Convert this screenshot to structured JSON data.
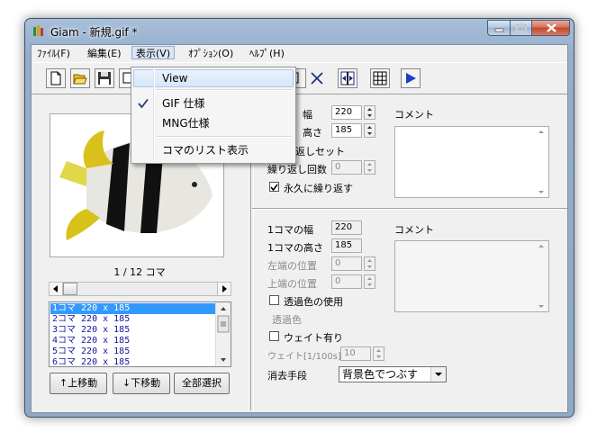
{
  "window": {
    "title": "Giam - 新規.gif *"
  },
  "menubar": {
    "items": [
      "ﾌｧｲﾙ(F)",
      "編集(E)",
      "表示(V)",
      "ｵﾌﾟｼｮﾝ(O)",
      "ﾍﾙﾌﾟ(H)"
    ]
  },
  "view_menu": {
    "items": [
      "View",
      "GIF 仕様",
      "MNG仕様",
      "コマのリスト表示"
    ],
    "checked_item": "GIF 仕様"
  },
  "left": {
    "frame_counter": "1 / 12 コマ",
    "frames": [
      "1コマ 220 x 185",
      "2コマ 220 x 185",
      "3コマ 220 x 185",
      "4コマ 220 x 185",
      "5コマ 220 x 185",
      "6コマ 220 x 185"
    ],
    "move_up_label": "↑上移動",
    "move_down_label": "↓下移動",
    "select_all_label": "全部選択"
  },
  "global": {
    "width_label": "幅",
    "width_value": "220",
    "height_label": "高さ",
    "height_value": "185",
    "loop_set_label": "返しセット",
    "loop_count_label": "繰り返し回数",
    "loop_count_value": "0",
    "loop_forever_label": "永久に繰り返す",
    "comment_label": "コメント"
  },
  "frame": {
    "width_label": "1コマの幅",
    "width_value": "220",
    "height_label": "1コマの高さ",
    "height_value": "185",
    "left_label": "左端の位置",
    "left_value": "0",
    "top_label": "上端の位置",
    "top_value": "0",
    "transparent_label": "透過色の使用",
    "transparent_color_label": "透過色",
    "wait_label": "ウェイト有り",
    "wait_time_label": "ウェイト[1/100s]",
    "wait_time_value": "10",
    "dispose_label": "消去手段",
    "dispose_value": "背景色でつぶす",
    "comment_label": "コメント"
  },
  "colors": {
    "selection": "#3399ff",
    "play_icon": "#1f3fbf"
  }
}
